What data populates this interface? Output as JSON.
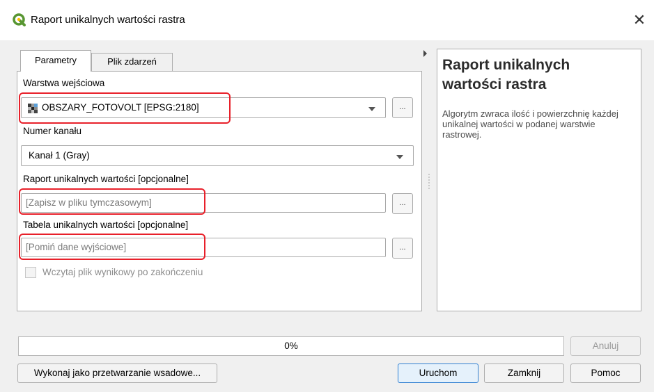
{
  "window": {
    "title": "Raport unikalnych wartości rastra",
    "close_glyph": "✕",
    "app_icon": "qgis-icon"
  },
  "tabs": [
    {
      "label": "Parametry",
      "active": true
    },
    {
      "label": "Plik zdarzeń",
      "active": false
    }
  ],
  "form": {
    "input_layer": {
      "label": "Warstwa wejściowa",
      "value": "OBSZARY_FOTOVOLT [EPSG:2180]",
      "browse_label": "..."
    },
    "band": {
      "label": "Numer kanału",
      "value": "Kanał 1 (Gray)"
    },
    "report": {
      "label": "Raport unikalnych wartości [opcjonalne]",
      "placeholder": "[Zapisz w pliku tymczasowym]",
      "browse_label": "..."
    },
    "table": {
      "label": "Tabela unikalnych wartości [opcjonalne]",
      "placeholder": "[Pomiń dane wyjściowe]",
      "browse_label": "..."
    },
    "load_result": {
      "label": "Wczytaj plik wynikowy po zakończeniu",
      "checked": false,
      "enabled": false
    }
  },
  "description": {
    "title": "Raport unikalnych wartości rastra",
    "body": "Algorytm zwraca ilość i powierzchnię każdej unikalnej wartości w podanej warstwie rastrowej."
  },
  "progress": {
    "value": 0,
    "text": "0%"
  },
  "buttons": {
    "cancel": "Anuluj",
    "batch": "Wykonaj jako przetwarzanie wsadowe...",
    "run": "Uruchom",
    "close": "Zamknij",
    "help": "Pomoc"
  },
  "colors": {
    "highlight": "#e8202a",
    "accent": "#2f7fd1",
    "qgis_green": "#589632",
    "qgis_yellow": "#ffc000"
  }
}
